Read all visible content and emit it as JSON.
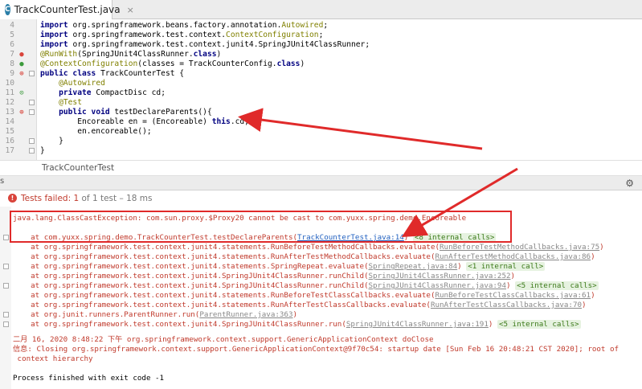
{
  "tab": {
    "icon": "java-class-icon",
    "title": "TrackCounterTest.java",
    "close": "×"
  },
  "code_lines": [
    {
      "n": "4",
      "parts": [
        [
          "kw",
          "import "
        ],
        [
          "",
          "org.springframework.beans.factory.annotation."
        ],
        [
          "ann",
          "Autowired"
        ],
        [
          "",
          ";"
        ]
      ]
    },
    {
      "n": "5",
      "parts": [
        [
          "kw",
          "import "
        ],
        [
          "",
          "org.springframework.test.context."
        ],
        [
          "ann",
          "ContextConfiguration"
        ],
        [
          "",
          ";"
        ]
      ]
    },
    {
      "n": "6",
      "parts": [
        [
          "kw",
          "import "
        ],
        [
          "",
          "org.springframework.test.context.junit4.SpringJUnit4ClassRunner;"
        ]
      ]
    },
    {
      "n": "7",
      "parts": [
        [
          "ann",
          "@RunWith"
        ],
        [
          "",
          "(SpringJUnit4ClassRunner."
        ],
        [
          "kw",
          "class"
        ],
        [
          "",
          ")"
        ]
      ]
    },
    {
      "n": "8",
      "parts": [
        [
          "ann",
          "@ContextConfiguration"
        ],
        [
          "",
          "(classes = TrackCounterConfig."
        ],
        [
          "kw",
          "class"
        ],
        [
          "",
          ")"
        ]
      ]
    },
    {
      "n": "9",
      "parts": [
        [
          "kw",
          "public class "
        ],
        [
          "",
          "TrackCounterTest {"
        ]
      ]
    },
    {
      "n": "10",
      "parts": [
        [
          "",
          "    "
        ],
        [
          "ann",
          "@Autowired"
        ]
      ]
    },
    {
      "n": "11",
      "parts": [
        [
          "",
          "    "
        ],
        [
          "kw",
          "private "
        ],
        [
          "",
          "CompactDisc cd;"
        ]
      ]
    },
    {
      "n": "12",
      "parts": [
        [
          "",
          "    "
        ],
        [
          "ann",
          "@Test"
        ]
      ]
    },
    {
      "n": "13",
      "parts": [
        [
          "",
          "    "
        ],
        [
          "kw",
          "public void "
        ],
        [
          "",
          "testDeclareParents(){"
        ]
      ]
    },
    {
      "n": "14",
      "parts": [
        [
          "",
          "        Encoreable en = (Encoreable) "
        ],
        [
          "kw",
          "this"
        ],
        [
          "",
          ".cd;"
        ]
      ]
    },
    {
      "n": "15",
      "parts": [
        [
          "",
          "        en.encoreable();"
        ]
      ]
    },
    {
      "n": "16",
      "parts": [
        [
          "",
          "    }"
        ]
      ]
    },
    {
      "n": "17",
      "parts": [
        [
          "",
          "}"
        ]
      ]
    }
  ],
  "breadcrumb": "TrackCounterTest",
  "run_bar": {
    "left_label": "s",
    "gear": "⚙"
  },
  "status": {
    "label": "Tests failed:",
    "count": "1",
    "of": "of 1 test",
    "time": "– 18 ms"
  },
  "console": {
    "exception": "java.lang.ClassCastException: com.sun.proxy.$Proxy20 cannot be cast to com.yuxx.spring.demo.Encoreable",
    "frames": [
      {
        "pre": "    at com.yuxx.spring.demo.TrackCounterTest.testDeclareParents(",
        "link": "TrackCounterTest.java:14",
        "post": ")",
        "badge": "<8 internal calls>",
        "blue": true
      },
      {
        "pre": "    at org.springframework.test.context.junit4.statements.RunBeforeTestMethodCallbacks.evaluate(",
        "link": "RunBeforeTestMethodCallbacks.java:75",
        "post": ")",
        "badge": ""
      },
      {
        "pre": "    at org.springframework.test.context.junit4.statements.RunAfterTestMethodCallbacks.evaluate(",
        "link": "RunAfterTestMethodCallbacks.java:86",
        "post": ")",
        "badge": ""
      },
      {
        "pre": "    at org.springframework.test.context.junit4.statements.SpringRepeat.evaluate(",
        "link": "SpringRepeat.java:84",
        "post": ")",
        "badge": "<1 internal call>"
      },
      {
        "pre": "    at org.springframework.test.context.junit4.SpringJUnit4ClassRunner.runChild(",
        "link": "SpringJUnit4ClassRunner.java:252",
        "post": ")",
        "badge": ""
      },
      {
        "pre": "    at org.springframework.test.context.junit4.SpringJUnit4ClassRunner.runChild(",
        "link": "SpringJUnit4ClassRunner.java:94",
        "post": ")",
        "badge": "<5 internal calls>"
      },
      {
        "pre": "    at org.springframework.test.context.junit4.statements.RunBeforeTestClassCallbacks.evaluate(",
        "link": "RunBeforeTestClassCallbacks.java:61",
        "post": ")",
        "badge": ""
      },
      {
        "pre": "    at org.springframework.test.context.junit4.statements.RunAfterTestClassCallbacks.evaluate(",
        "link": "RunAfterTestClassCallbacks.java:70",
        "post": ")",
        "badge": ""
      },
      {
        "pre": "    at org.junit.runners.ParentRunner.run(",
        "link": "ParentRunner.java:363",
        "post": ")",
        "badge": ""
      },
      {
        "pre": "    at org.springframework.test.context.junit4.SpringJUnit4ClassRunner.run(",
        "link": "SpringJUnit4ClassRunner.java:191",
        "post": ")",
        "badge": "<5 internal calls>"
      }
    ],
    "log1": "二月 16, 2020 8:48:22 下午 org.springframework.context.support.GenericApplicationContext doClose",
    "log2": "信息: Closing org.springframework.context.support.GenericApplicationContext@9f70c54: startup date [Sun Feb 16 20:48:21 CST 2020]; root of",
    "log3": " context hierarchy",
    "finished": "Process finished with exit code -1"
  },
  "colors": {
    "annotation_box": "#e02a2a",
    "error_text": "#c0392b",
    "keyword": "#000080",
    "annotation": "#808000"
  }
}
